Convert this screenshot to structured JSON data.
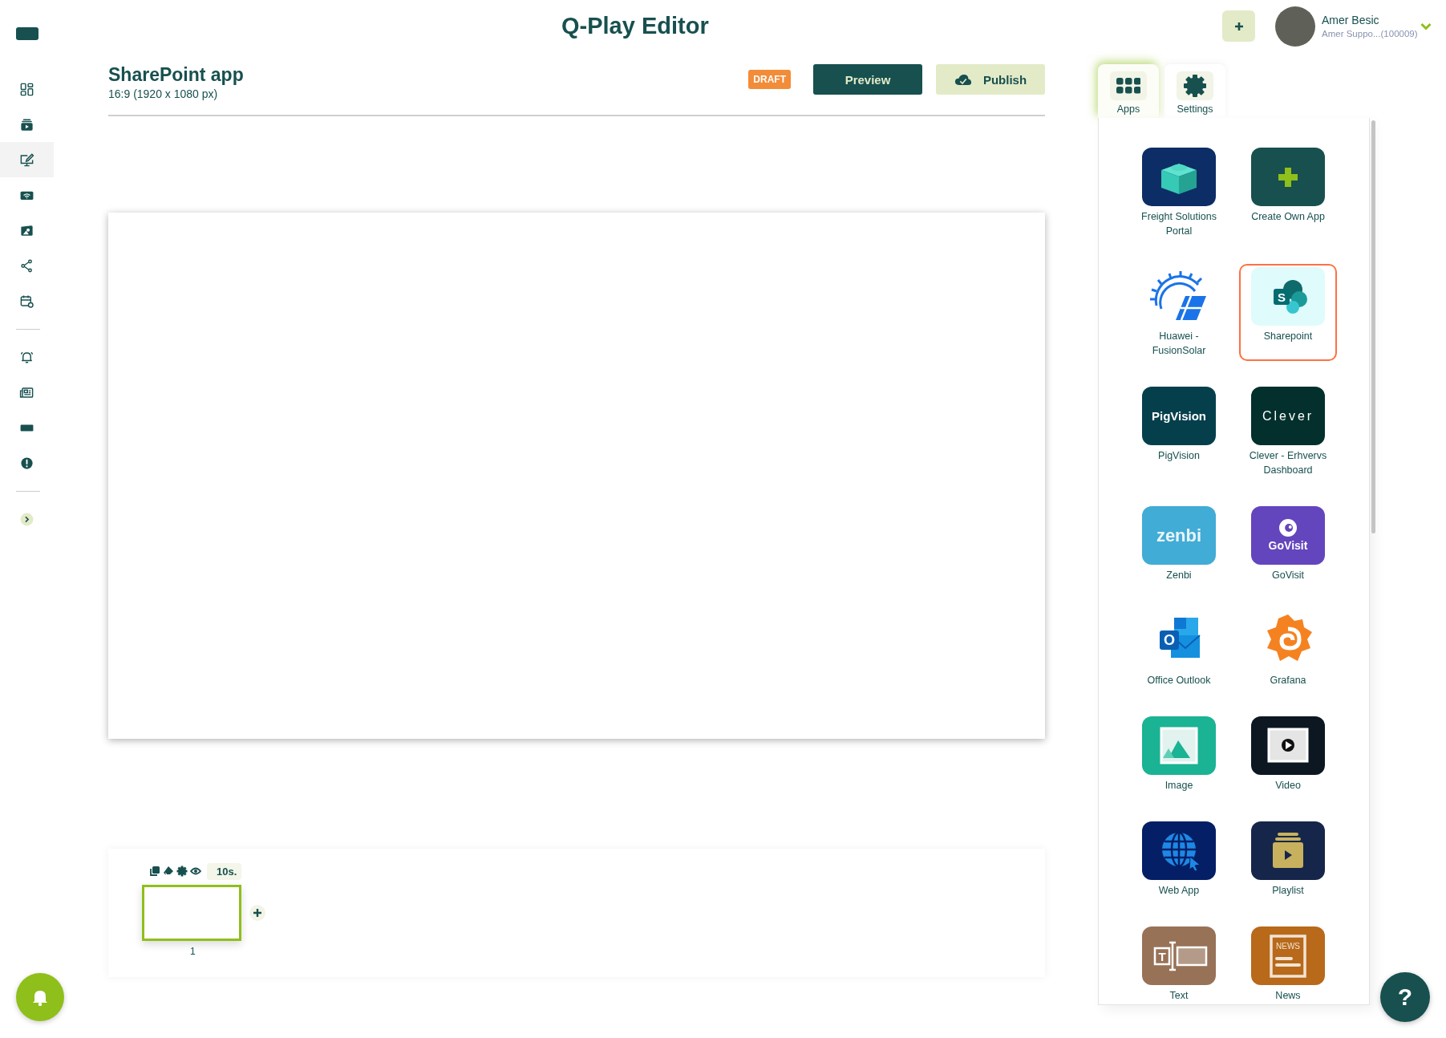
{
  "title": "Q-Play Editor",
  "sidebar": {
    "groups": [
      {
        "items": [
          {
            "kind": "dashboard",
            "selected": false
          },
          {
            "kind": "playlist",
            "selected": false
          },
          {
            "kind": "editor",
            "selected": true
          },
          {
            "kind": "wifi",
            "selected": false
          },
          {
            "kind": "media",
            "selected": false
          },
          {
            "kind": "share",
            "selected": false
          },
          {
            "kind": "calendar",
            "selected": false
          }
        ]
      },
      {
        "items": [
          {
            "kind": "alarm",
            "selected": false
          },
          {
            "kind": "news",
            "selected": false
          },
          {
            "kind": "rectangle",
            "selected": false
          },
          {
            "kind": "alert",
            "selected": false
          }
        ]
      },
      {
        "items": [
          {
            "kind": "expand",
            "selected": false
          }
        ]
      }
    ]
  },
  "user": {
    "name": "Amer Besic",
    "account": "Amer Suppo...(100009)"
  },
  "document": {
    "name": "SharePoint app",
    "format": "16:9 (1920 x 1080 px)",
    "status": "DRAFT",
    "actions": [
      {
        "label": "Preview",
        "kind": "preview"
      },
      {
        "label": "Publish",
        "kind": "publish"
      }
    ]
  },
  "timeline": {
    "slides": [
      {
        "duration": "10s.",
        "number": "1",
        "selected": true
      }
    ]
  },
  "panel": {
    "tabs": [
      {
        "label": "Apps",
        "kind": "apps",
        "selected": true
      },
      {
        "label": "Settings",
        "kind": "settings",
        "selected": false
      }
    ],
    "apps": [
      {
        "label": "Freight Solutions Portal",
        "kind": "freight",
        "selected": false
      },
      {
        "label": "Create Own App",
        "kind": "create",
        "selected": false
      },
      {
        "label": "Huawei - FusionSolar",
        "kind": "solar",
        "selected": false
      },
      {
        "label": "Sharepoint",
        "kind": "sharepoint",
        "logo_text": "S",
        "selected": true
      },
      {
        "label": "PigVision",
        "kind": "pigvision",
        "logo_text": "PigVision",
        "selected": false
      },
      {
        "label": "Clever - Erhvervs Dashboard",
        "kind": "clever",
        "logo_text": "Clever",
        "selected": false
      },
      {
        "label": "Zenbi",
        "kind": "zenbi",
        "logo_text": "zenbi",
        "selected": false
      },
      {
        "label": "GoVisit",
        "kind": "govisit",
        "logo_text": "GoVisit",
        "selected": false
      },
      {
        "label": "Office Outlook",
        "kind": "outlook",
        "logo_text": "O",
        "selected": false
      },
      {
        "label": "Grafana",
        "kind": "grafana",
        "selected": false
      },
      {
        "label": "Image",
        "kind": "image",
        "selected": false
      },
      {
        "label": "Video",
        "kind": "video",
        "selected": false
      },
      {
        "label": "Web App",
        "kind": "webapp",
        "selected": false
      },
      {
        "label": "Playlist",
        "kind": "playlist",
        "selected": false
      },
      {
        "label": "Text",
        "kind": "text",
        "logo_text": "T",
        "selected": false
      },
      {
        "label": "News",
        "kind": "news",
        "logo_text": "NEWS",
        "selected": false
      }
    ]
  },
  "help": {
    "label": "?"
  }
}
